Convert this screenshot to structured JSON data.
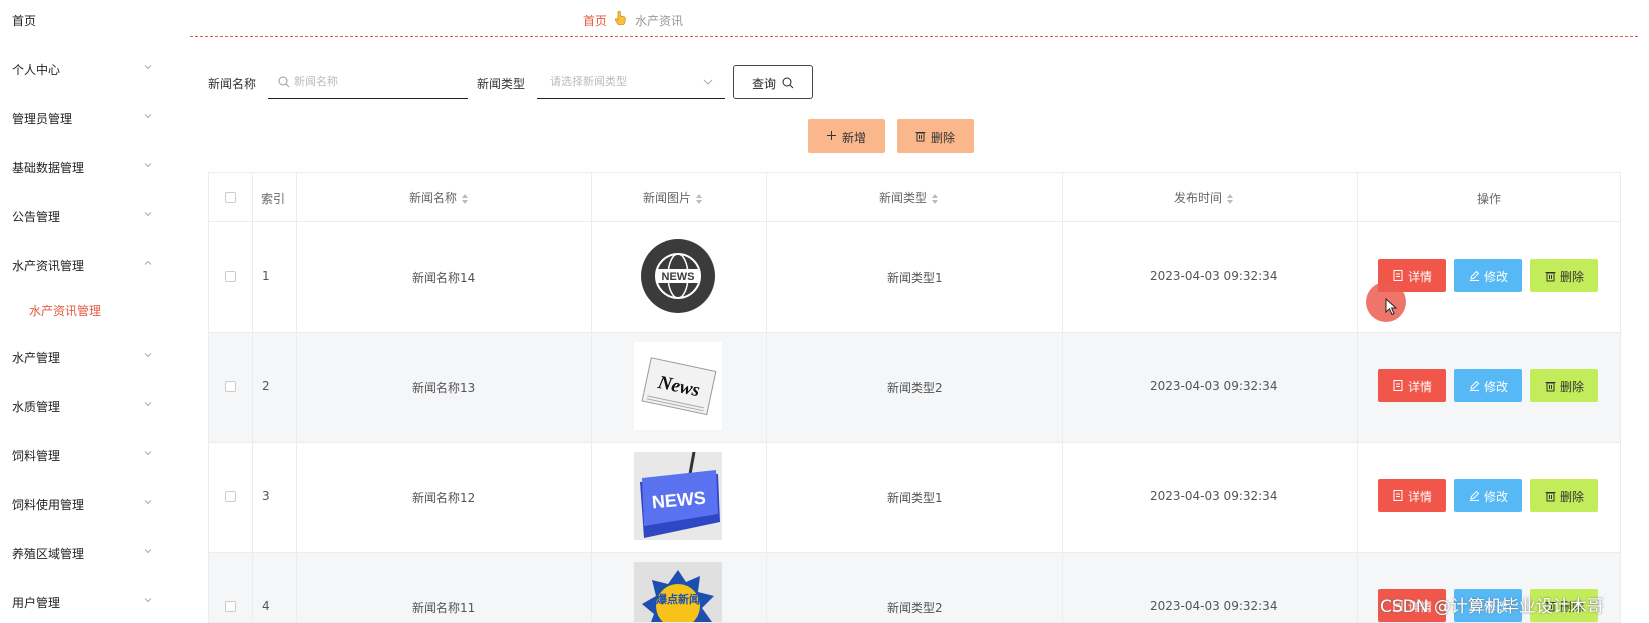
{
  "sidebar": {
    "items": [
      {
        "label": "首页"
      },
      {
        "label": "个人中心"
      },
      {
        "label": "管理员管理"
      },
      {
        "label": "基础数据管理"
      },
      {
        "label": "公告管理"
      },
      {
        "label": "水产资讯管理"
      },
      {
        "label": "水产管理"
      },
      {
        "label": "水质管理"
      },
      {
        "label": "饲料管理"
      },
      {
        "label": "饲料使用管理"
      },
      {
        "label": "养殖区域管理"
      },
      {
        "label": "用户管理"
      }
    ],
    "active_sub": "水产资讯管理"
  },
  "breadcrumb": {
    "home": "首页",
    "current": "水产资讯"
  },
  "search": {
    "name_label": "新闻名称",
    "name_placeholder": "新闻名称",
    "type_label": "新闻类型",
    "type_placeholder": "请选择新闻类型",
    "query_label": "查询"
  },
  "actions": {
    "add_label": "新增",
    "delete_label": "删除"
  },
  "table": {
    "headers": {
      "index": "索引",
      "name": "新闻名称",
      "image": "新闻图片",
      "type": "新闻类型",
      "time": "发布时间",
      "ops": "操作"
    },
    "rows": [
      {
        "index": "1",
        "name": "新闻名称14",
        "image_text": "NEWS",
        "type": "新闻类型1",
        "time": "2023-04-03 09:32:34"
      },
      {
        "index": "2",
        "name": "新闻名称13",
        "image_text": "News",
        "type": "新闻类型2",
        "time": "2023-04-03 09:32:34"
      },
      {
        "index": "3",
        "name": "新闻名称12",
        "image_text": "NEWS",
        "type": "新闻类型1",
        "time": "2023-04-03 09:32:34"
      },
      {
        "index": "4",
        "name": "新闻名称11",
        "image_text": "爆点新闻",
        "type": "新闻类型2",
        "time": "2023-04-03 09:32:34"
      }
    ],
    "op_labels": {
      "detail": "详情",
      "edit": "修改",
      "delete": "删除"
    }
  },
  "watermark": "CSDN @计算机毕业设计木哥",
  "colors": {
    "accent": "#e5593f",
    "add_btn": "#f9b78b",
    "detail_btn": "#f0574a",
    "edit_btn": "#56b9f5",
    "delete_btn": "#c3ec5a"
  }
}
